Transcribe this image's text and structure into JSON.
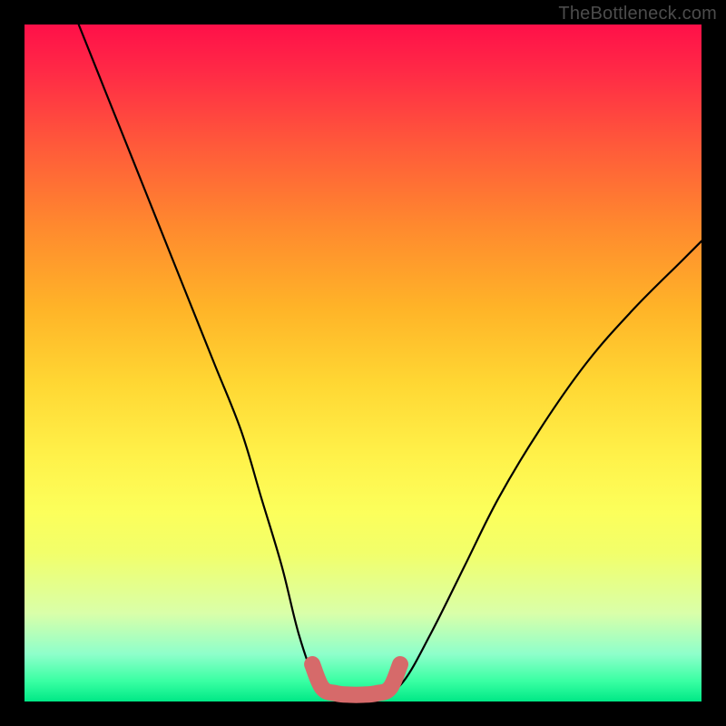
{
  "watermark": "TheBottleneck.com",
  "chart_data": {
    "type": "line",
    "title": "",
    "xlabel": "",
    "ylabel": "",
    "xlim": [
      0,
      100
    ],
    "ylim": [
      0,
      100
    ],
    "series": [
      {
        "name": "bottleneck-curve",
        "x": [
          8,
          12,
          16,
          20,
          24,
          28,
          32,
          35,
          38,
          40.5,
          43,
          45,
          47,
          50,
          53,
          56,
          60,
          65,
          70,
          76,
          83,
          90,
          97,
          100
        ],
        "values": [
          100,
          90,
          80,
          70,
          60,
          50,
          40,
          30,
          20,
          10,
          3,
          1,
          1,
          1,
          1,
          3,
          10,
          20,
          30,
          40,
          50,
          58,
          65,
          68
        ]
      }
    ],
    "highlight": {
      "name": "optimal-range",
      "x": [
        42.5,
        44,
        46,
        48,
        50,
        52,
        54,
        55.5
      ],
      "values": [
        5.5,
        2.0,
        1.2,
        1.0,
        1.0,
        1.2,
        2.0,
        5.5
      ],
      "color": "#d66a6a"
    }
  }
}
